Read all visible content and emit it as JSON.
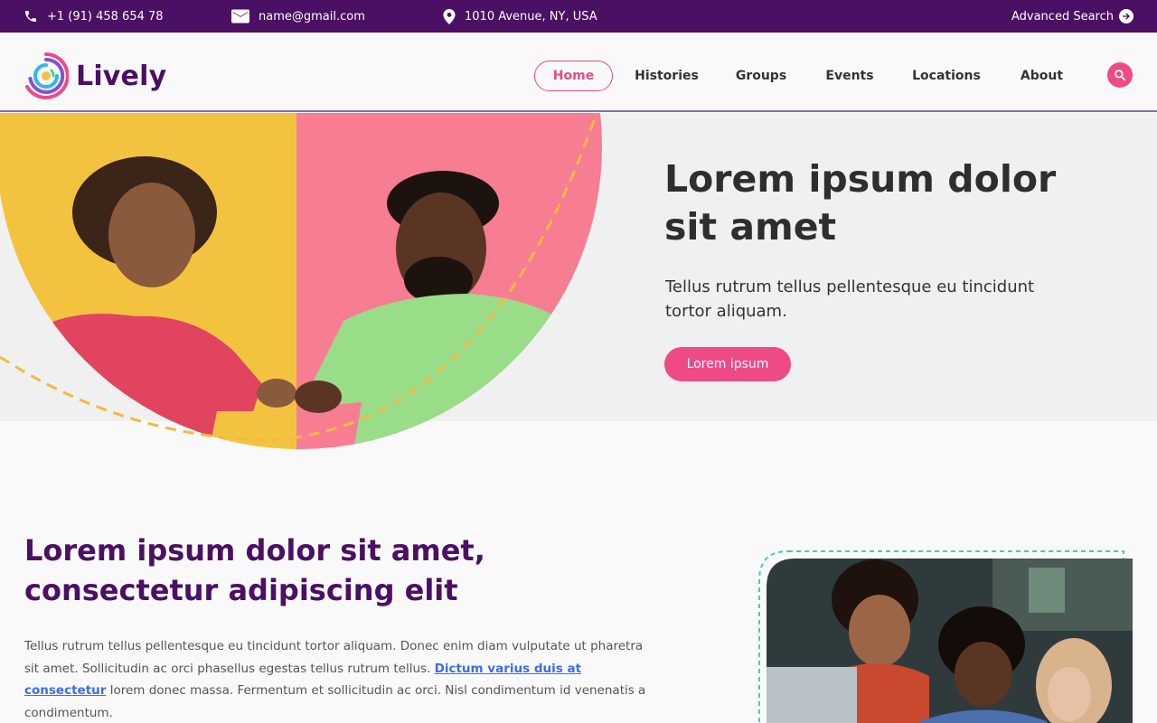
{
  "topbar": {
    "phone": "+1 (91) 458 654 78",
    "email": "name@gmail.com",
    "address": "1010 Avenue, NY, USA",
    "advanced_search": "Advanced Search",
    "icons": [
      "phone-icon",
      "mail-icon",
      "location-pin-icon",
      "arrow-right-circle-icon"
    ]
  },
  "header": {
    "logo_text": "Lively",
    "nav": [
      "Home",
      "Histories",
      "Groups",
      "Events",
      "Locations",
      "About"
    ],
    "active_nav": "Home",
    "search_icon": "search-icon"
  },
  "hero": {
    "title": "Lorem ipsum dolor sit amet",
    "subtitle": "Tellus rutrum tellus pellentesque eu tincidunt tortor aliquam.",
    "button": "Lorem ipsum"
  },
  "section": {
    "title": "Lorem ipsum dolor sit amet, consectetur adipiscing elit",
    "body_before": "Tellus rutrum tellus pellentesque eu tincidunt tortor aliquam. Donec enim diam vulputate ut pharetra sit amet. Sollicitudin ac orci phasellus egestas tellus rutrum tellus. ",
    "link": "Dictum varius duis at consectetur",
    "body_after": " lorem donec massa. Fermentum et sollicitudin ac orci. Nisl condimentum id venenatis a condimentum."
  },
  "colors": {
    "brand_purple": "#4b0f63",
    "accent_pink": "#ee4b86",
    "link_blue": "#3b6ee8",
    "hero_yellow": "#f3c340",
    "hero_pink": "#f77d93",
    "dash_green": "#3fd69a"
  }
}
